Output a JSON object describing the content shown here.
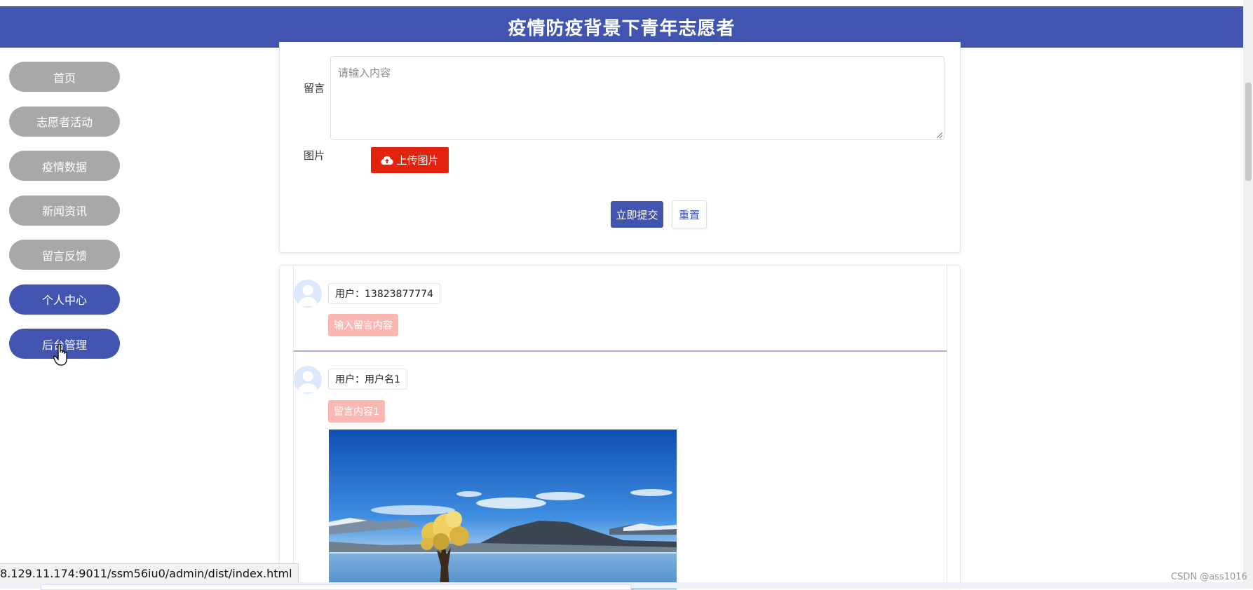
{
  "header": {
    "title": "疫情防疫背景下青年志愿者"
  },
  "sidebar": {
    "items": [
      {
        "label": "首页"
      },
      {
        "label": "志愿者活动"
      },
      {
        "label": "疫情数据"
      },
      {
        "label": "新闻资讯"
      },
      {
        "label": "留言反馈"
      },
      {
        "label": "个人中心"
      },
      {
        "label": "后台管理"
      }
    ]
  },
  "form": {
    "message_label": "留言",
    "message_placeholder": "请输入内容",
    "image_label": "图片",
    "upload_label": "上传图片",
    "submit_label": "立即提交",
    "reset_label": "重置"
  },
  "comments": [
    {
      "user": "用户：13823877774",
      "content": "输入留言内容"
    },
    {
      "user": "用户：用户名1",
      "content": "留言内容1"
    }
  ],
  "status_url": "8.129.11.174:9011/ssm56iu0/admin/dist/index.html",
  "watermark": "CSDN @ass1016",
  "colors": {
    "primary": "#4154b0",
    "nav_inactive": "#a8a8a8",
    "upload": "#e2230e",
    "message_tag": "#fbb7b2"
  }
}
